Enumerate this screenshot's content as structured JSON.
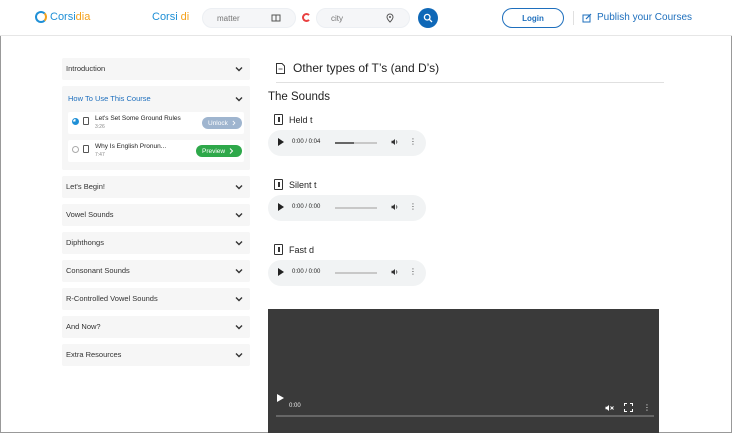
{
  "header": {
    "logo_text_main": "Corsi",
    "logo_text_accent": "dia",
    "brand_main": "Corsi",
    "brand_accent": "di",
    "matter_placeholder": "matter",
    "city_placeholder": "city",
    "login_label": "Login",
    "publish_label": "Publish your Courses"
  },
  "sidebar": {
    "sections": [
      {
        "label": "Introduction"
      },
      {
        "label": "How To Use This Course",
        "open": true,
        "lessons": [
          {
            "title": "Let's Set Some Ground Rules",
            "duration": "3:26",
            "tag": "Unlock",
            "done": true
          },
          {
            "title": "Why Is English Pronun...",
            "duration": "7:47",
            "tag": "Preview",
            "done": false
          }
        ]
      },
      {
        "label": "Let's Begin!"
      },
      {
        "label": "Vowel Sounds"
      },
      {
        "label": "Diphthongs"
      },
      {
        "label": "Consonant Sounds"
      },
      {
        "label": "R-Controlled Vowel Sounds"
      },
      {
        "label": "And Now?"
      },
      {
        "label": "Extra Resources"
      }
    ]
  },
  "main": {
    "page_title": "Other types of T’s (and D’s)",
    "section_heading": "The Sounds",
    "audios": [
      {
        "title": "Held t",
        "time": "0:00 / 0:04",
        "progress": 0.45
      },
      {
        "title": "Silent t",
        "time": "0:00 / 0:00",
        "progress": 0
      },
      {
        "title": "Fast d",
        "time": "0:00 / 0:00",
        "progress": 0
      }
    ],
    "video": {
      "time": "0:00"
    }
  },
  "colors": {
    "brand_blue": "#1e8fd6",
    "brand_orange": "#f4a11b",
    "link_blue": "#1e6fbd",
    "preview_green": "#2ea84a",
    "unlock_gray_blue": "#9fb5cf"
  }
}
